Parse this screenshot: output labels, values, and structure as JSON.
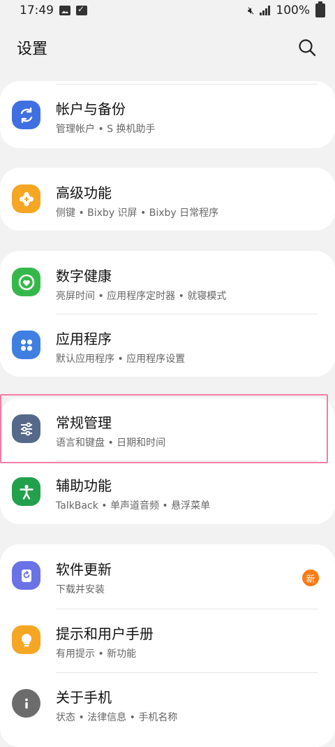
{
  "status_bar": {
    "time": "17:49",
    "battery": "100%"
  },
  "header": {
    "title": "设置"
  },
  "colors": {
    "accounts_icon": "#3f6fe0",
    "advanced_icon": "#f5a623",
    "wellbeing_icon": "#35b84a",
    "apps_icon": "#3f7fe2",
    "general_icon": "#56698a",
    "accessibility_icon": "#23a04c",
    "update_icon": "#6a72e6",
    "tips_icon": "#f5a623",
    "about_icon": "#6c6c6c",
    "badge": "#ff7a10",
    "highlight": "#f27ea3"
  },
  "items": {
    "accounts": {
      "title": "帐户与备份",
      "subtitle": "管理帐户 • S 换机助手",
      "icon": "sync-icon"
    },
    "advanced": {
      "title": "高级功能",
      "subtitle": "侧键 • Bixby 识屏 • Bixby 日常程序",
      "icon": "puzzle-icon"
    },
    "wellbeing": {
      "title": "数字健康",
      "subtitle": "亮屏时间 • 应用程序定时器 • 就寝模式",
      "icon": "wellbeing-heart-icon"
    },
    "apps": {
      "title": "应用程序",
      "subtitle": "默认应用程序 • 应用程序设置",
      "icon": "apps-grid-icon"
    },
    "general": {
      "title": "常规管理",
      "subtitle": "语言和键盘 • 日期和时间",
      "icon": "sliders-icon"
    },
    "accessibility": {
      "title": "辅助功能",
      "subtitle": "TalkBack • 单声道音频 • 悬浮菜单",
      "icon": "accessibility-person-icon"
    },
    "update": {
      "title": "软件更新",
      "subtitle": "下载并安装",
      "icon": "update-arrow-icon",
      "badge": "新"
    },
    "tips": {
      "title": "提示和用户手册",
      "subtitle": "有用提示 • 新功能",
      "icon": "lightbulb-icon"
    },
    "about": {
      "title": "关于手机",
      "subtitle": "状态 • 法律信息 • 手机名称",
      "icon": "info-icon"
    }
  }
}
